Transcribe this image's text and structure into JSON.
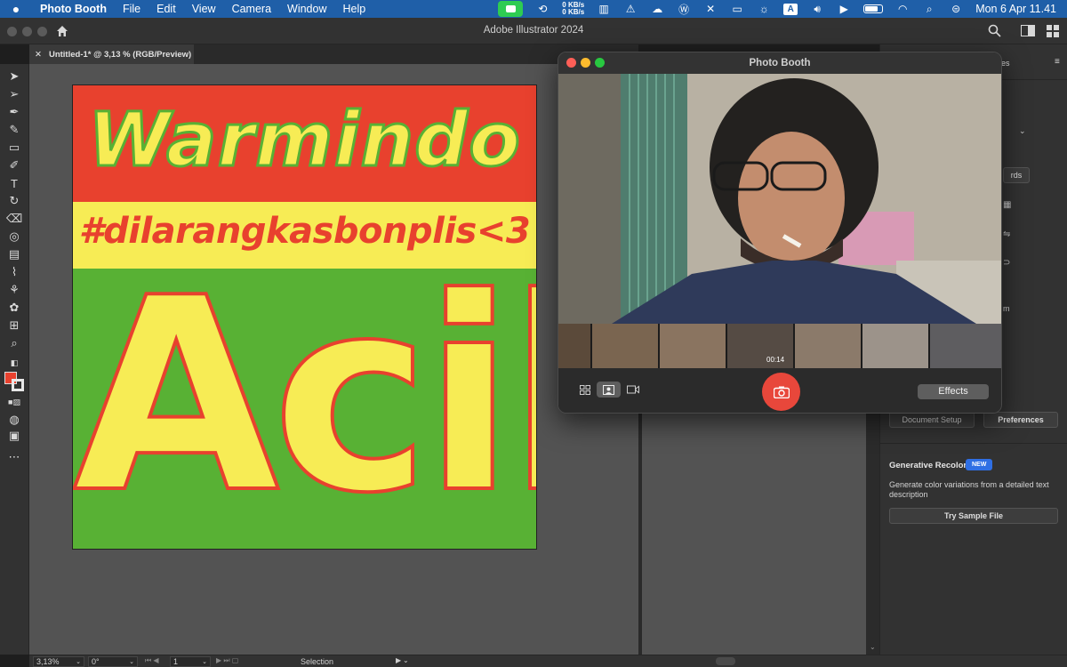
{
  "menubar": {
    "app_name": "Photo Booth",
    "items": [
      "File",
      "Edit",
      "View",
      "Camera",
      "Window",
      "Help"
    ],
    "net_up": "0 KB/s",
    "net_down": "0 KB/s",
    "keyboard_input": "A",
    "datetime": "Mon 6 Apr  11.41"
  },
  "illustrator": {
    "window_title": "Adobe Illustrator 2024",
    "doc_tab": "Untitled-1* @ 3,13 % (RGB/Preview)",
    "artboard": {
      "line1": "Warmindo",
      "line2": "#dilarangkasbonplis<3",
      "line3": "Acil",
      "colors": {
        "red": "#e8412e",
        "yellow": "#f7ec55",
        "green": "#58b134"
      }
    },
    "panel": {
      "tab_suffix": "es",
      "partial_label_1": "rds",
      "partial_label_2": "m",
      "document_setup": "Document Setup",
      "preferences": "Preferences",
      "generative_title": "Generative Recolor",
      "new_badge": "NEW",
      "generative_desc": "Generate color variations from a detailed text description",
      "try_sample": "Try Sample File"
    },
    "statusbar": {
      "zoom": "3,13%",
      "rotation": "0°",
      "artboard_num": "1",
      "tool": "Selection"
    }
  },
  "photobooth": {
    "title": "Photo Booth",
    "thumb_timestamp": "00:14",
    "effects_label": "Effects"
  }
}
